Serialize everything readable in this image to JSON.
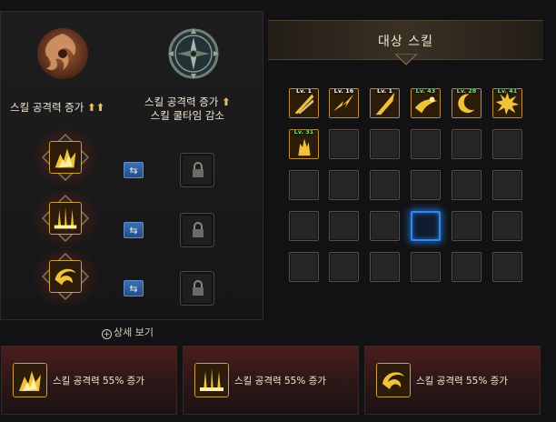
{
  "options": [
    {
      "label": "스킬 공격력 증가",
      "arrows": "⬆⬆"
    },
    {
      "label_line1": "스킬 공격력 증가",
      "arrow": "⬆",
      "label_line2": "스킬 쿨타임 감소"
    }
  ],
  "detail_link": "상세 보기",
  "target_panel": {
    "title": "대상 스킬"
  },
  "grid_skills": [
    {
      "level": "Lv. 1",
      "color": "white"
    },
    {
      "level": "Lv. 16",
      "color": "white"
    },
    {
      "level": "Lv. 1",
      "color": "white"
    },
    {
      "level": "Lv. 43",
      "color": "green"
    },
    {
      "level": "Lv. 28",
      "color": "green"
    },
    {
      "level": "Lv. 41",
      "color": "green"
    },
    {
      "level": "Lv. 31",
      "color": "green"
    }
  ],
  "bottom_cards": [
    {
      "text": "스킬 공격력 55% 증가"
    },
    {
      "text": "스킬 공격력 55% 증가"
    },
    {
      "text": "스킬 공격력 55% 증가"
    }
  ],
  "colors": {
    "accent_gold": "#c8a048",
    "selected_blue": "#2f88f0",
    "level_green": "#6cf07a"
  }
}
